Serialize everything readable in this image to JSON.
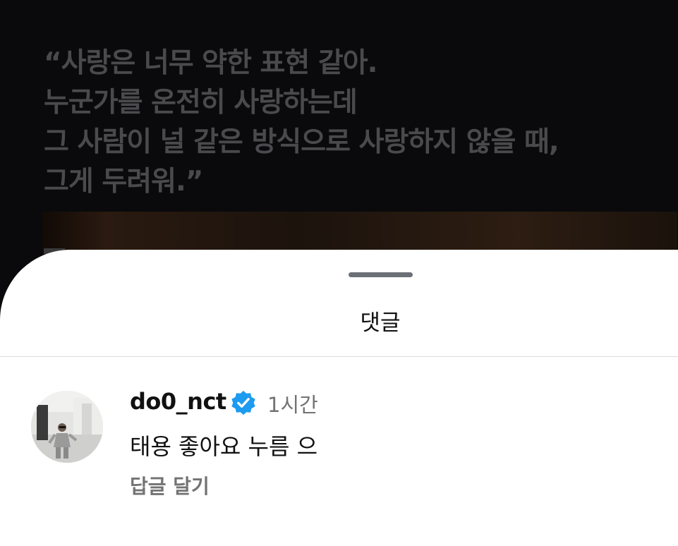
{
  "background": {
    "quote_lines": [
      "“사랑은 너무 약한 표현 같아.",
      " 누군가를 온전히 사랑하는데",
      " 그 사람이 널 같은 방식으로 사랑하지 않을 때,",
      " 그게 두려워.”"
    ]
  },
  "sheet": {
    "title": "댓글"
  },
  "comment": {
    "username": "do0_nct",
    "verified_icon": "verified-badge-icon",
    "time": "1시간",
    "text": "태용 좋아요 누름 으",
    "reply_label": "답글 달기"
  },
  "colors": {
    "verified_blue": "#1d9bf0",
    "secondary_text": "#737373",
    "background_dark": "#0a0a0c"
  }
}
